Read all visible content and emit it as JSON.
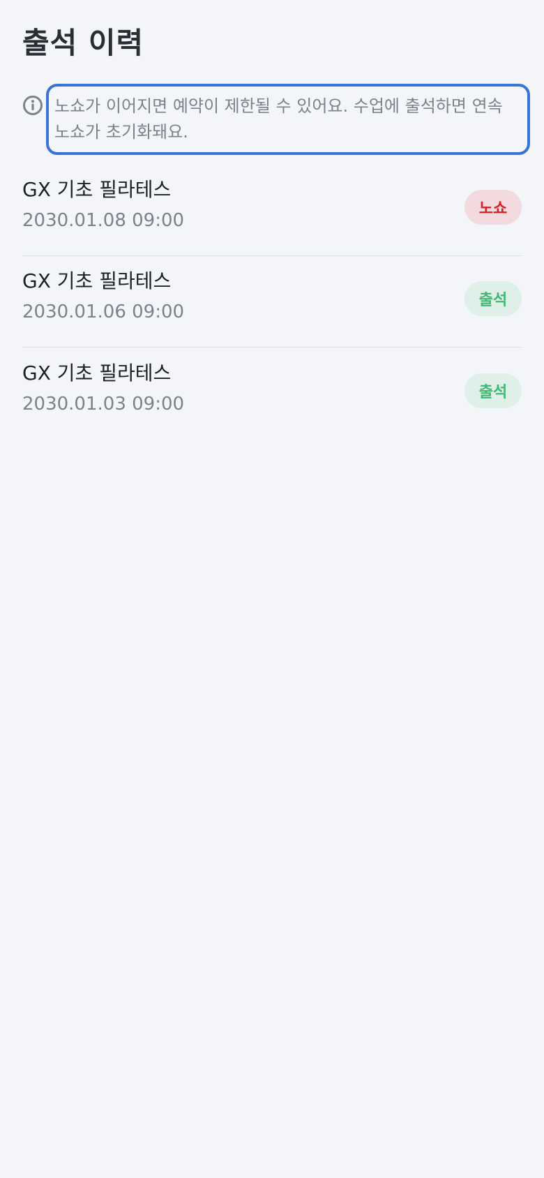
{
  "header": {
    "title": "출석 이력"
  },
  "notice": {
    "icon": "info-circle-icon",
    "text": "노쇼가 이어지면 예약이 제한될 수 있어요. 수업에 출석하면 연속 노쇼가 초기화돼요."
  },
  "history": [
    {
      "class_name": "GX 기초 필라테스",
      "datetime": "2030.01.08 09:00",
      "status": "노쇼",
      "status_type": "no-show",
      "status_color": "#d11f26",
      "status_bg": "#f2dade"
    },
    {
      "class_name": "GX 기초 필라테스",
      "datetime": "2030.01.06 09:00",
      "status": "출석",
      "status_type": "attended",
      "status_color": "#3fb872",
      "status_bg": "#dff0e8"
    },
    {
      "class_name": "GX 기초 필라테스",
      "datetime": "2030.01.03 09:00",
      "status": "출석",
      "status_type": "attended",
      "status_color": "#3fb872",
      "status_bg": "#dff0e8"
    }
  ]
}
